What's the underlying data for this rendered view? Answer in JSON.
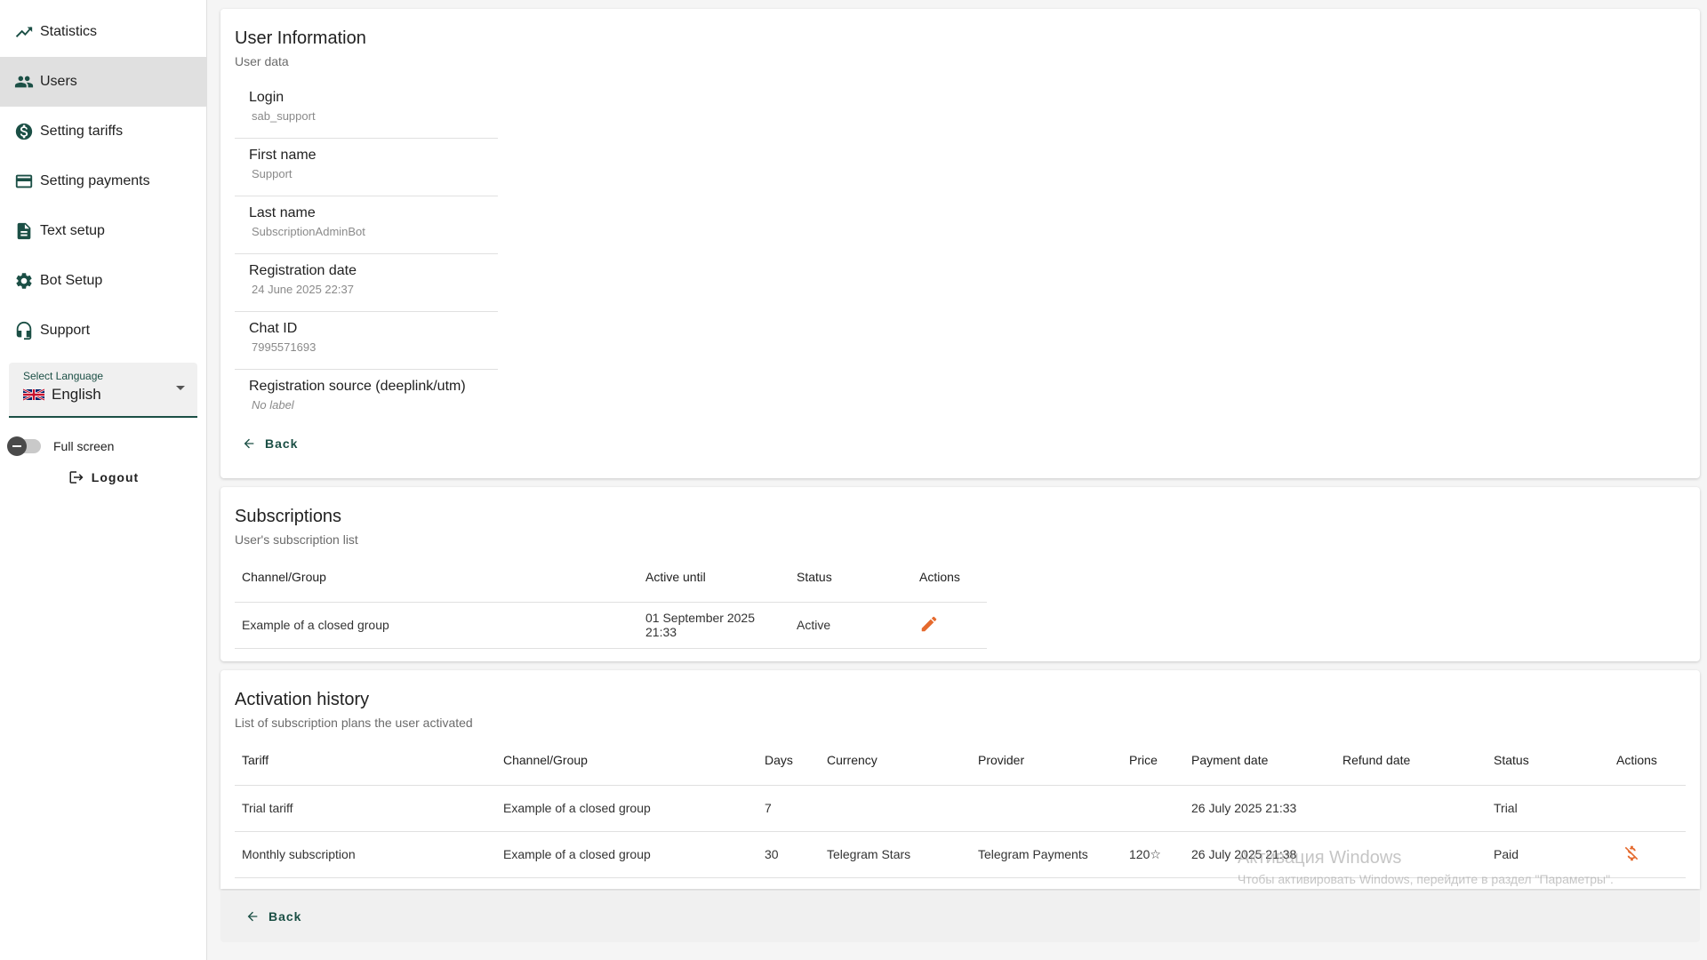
{
  "sidebar": {
    "items": [
      {
        "label": "Statistics",
        "icon": "chart-line-icon"
      },
      {
        "label": "Users",
        "icon": "users-icon"
      },
      {
        "label": "Setting tariffs",
        "icon": "dollar-circle-icon"
      },
      {
        "label": "Setting payments",
        "icon": "credit-card-icon"
      },
      {
        "label": "Text setup",
        "icon": "document-icon"
      },
      {
        "label": "Bot Setup",
        "icon": "gear-icon"
      },
      {
        "label": "Support",
        "icon": "headset-icon"
      }
    ],
    "active_index": 1,
    "language": {
      "label": "Select Language",
      "value": "English",
      "flag": "uk-flag-icon"
    },
    "fullscreen_label": "Full screen",
    "logout_label": "Logout"
  },
  "user_info": {
    "title": "User Information",
    "subtitle": "User data",
    "fields": [
      {
        "label": "Login",
        "value": "sab_support"
      },
      {
        "label": "First name",
        "value": "Support"
      },
      {
        "label": "Last name",
        "value": "SubscriptionAdminBot"
      },
      {
        "label": "Registration date",
        "value": "24 June 2025 22:37"
      },
      {
        "label": "Chat ID",
        "value": "7995571693"
      },
      {
        "label": "Registration source (deeplink/utm)",
        "value": "No label"
      }
    ],
    "back_label": "Back"
  },
  "subscriptions": {
    "title": "Subscriptions",
    "subtitle": "User's subscription list",
    "columns": [
      "Channel/Group",
      "Active until",
      "Status",
      "Actions"
    ],
    "rows": [
      {
        "channel": "Example of a closed group",
        "active_until_1": "01 September 2025",
        "active_until_2": "21:33",
        "status": "Active",
        "action_icon": "pencil-icon"
      }
    ]
  },
  "activation_history": {
    "title": "Activation history",
    "subtitle": "List of subscription plans the user activated",
    "columns": [
      "Tariff",
      "Channel/Group",
      "Days",
      "Currency",
      "Provider",
      "Price",
      "Payment date",
      "Refund date",
      "Status",
      "Actions"
    ],
    "rows": [
      {
        "tariff": "Trial tariff",
        "channel": "Example of a closed group",
        "days": "7",
        "currency": "",
        "provider": "",
        "price": "",
        "payment_date": "26 July 2025 21:33",
        "refund_date": "",
        "status": "Trial"
      },
      {
        "tariff": "Monthly subscription",
        "channel": "Example of a closed group",
        "days": "30",
        "currency": "Telegram Stars",
        "provider": "Telegram Payments",
        "price": "120☆",
        "payment_date": "26 July 2025 21:38",
        "refund_date": "",
        "status": "Paid",
        "action_icon": "refund-dollar-icon"
      }
    ]
  },
  "footer": {
    "back_label": "Back"
  },
  "watermark": {
    "title": "Активация Windows",
    "subtitle": "Чтобы активировать Windows, перейдите в раздел \"Параметры\"."
  },
  "colors": {
    "accent": "#1b4f45",
    "action": "#e56a2e",
    "active_nav": "#e0e0e0"
  }
}
